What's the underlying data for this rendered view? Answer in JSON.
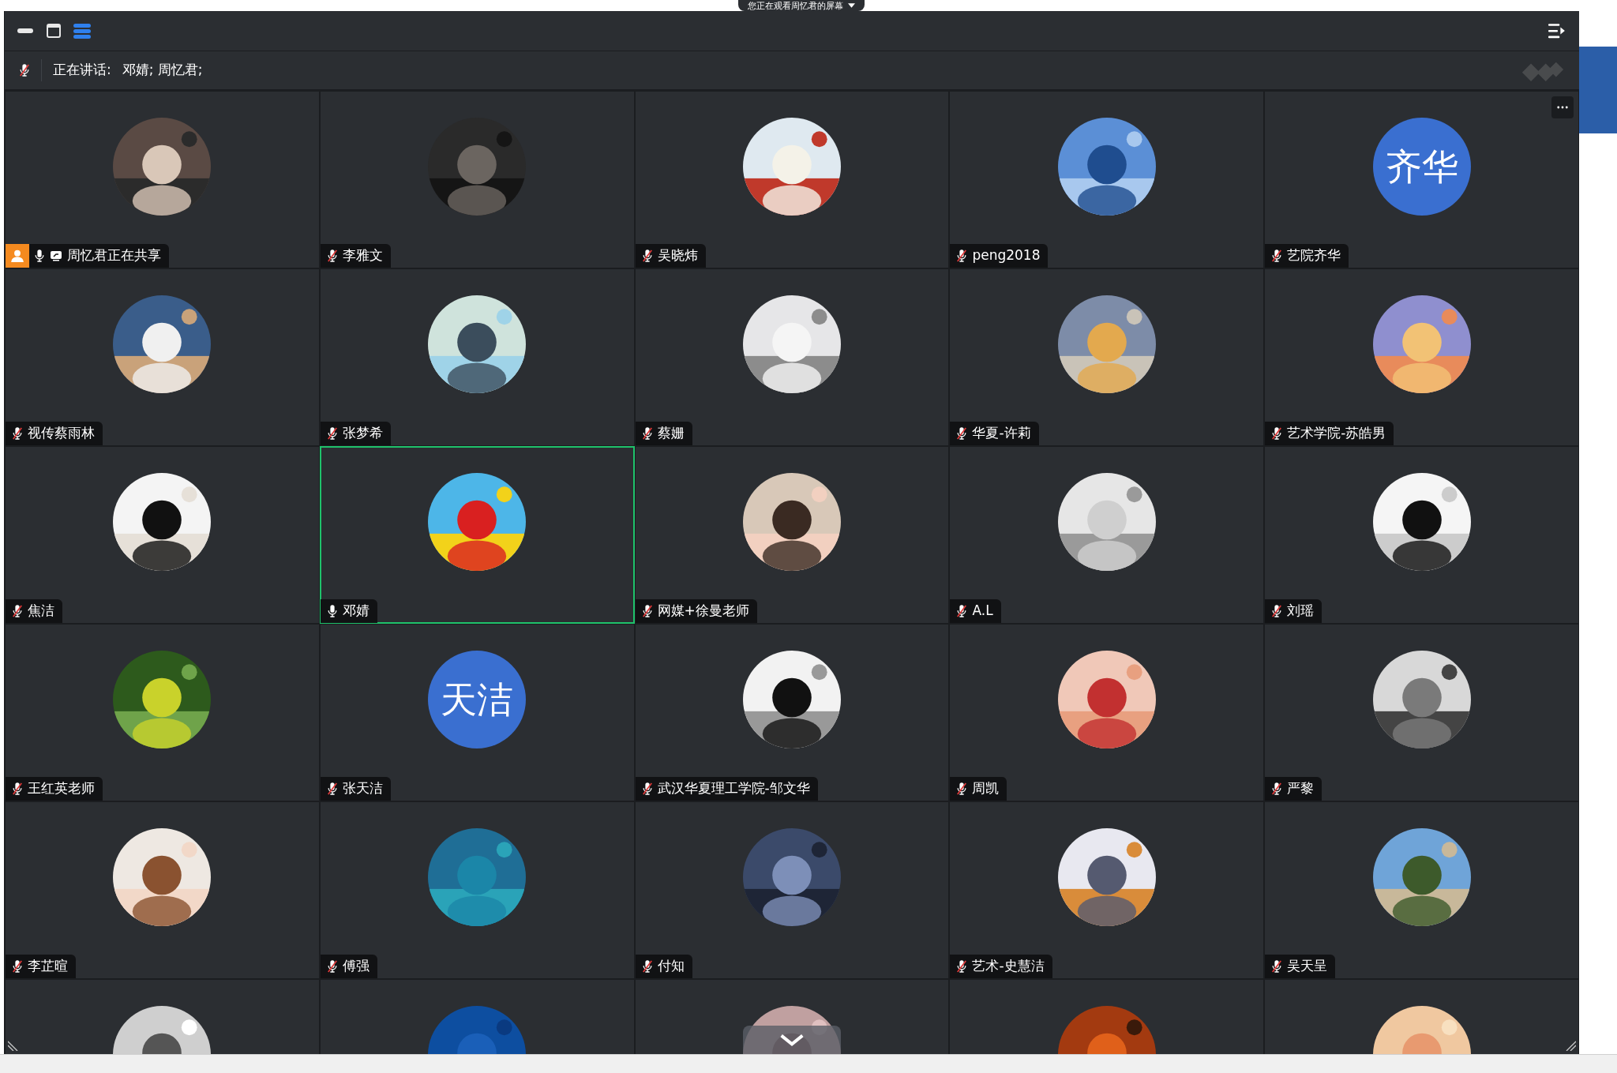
{
  "banner": {
    "text": "您正在观看周忆君的屏幕"
  },
  "speaking_bar": {
    "label": "正在讲话:",
    "names": "邓婧; 周忆君;"
  },
  "participants": [
    {
      "name": "周忆君正在共享",
      "muted": false,
      "sharing": true,
      "selected": false
    },
    {
      "name": "李雅文",
      "muted": true,
      "sharing": false,
      "selected": false
    },
    {
      "name": "吴晓炜",
      "muted": true,
      "sharing": false,
      "selected": false
    },
    {
      "name": "peng2018",
      "muted": true,
      "sharing": false,
      "selected": false
    },
    {
      "name": "艺院齐华",
      "muted": true,
      "sharing": false,
      "selected": false,
      "avatar": {
        "kind": "text",
        "text": "齐华"
      }
    },
    {
      "name": "视传蔡雨林",
      "muted": true,
      "sharing": false,
      "selected": false
    },
    {
      "name": "张梦希",
      "muted": true,
      "sharing": false,
      "selected": false
    },
    {
      "name": "蔡姗",
      "muted": true,
      "sharing": false,
      "selected": false
    },
    {
      "name": "华夏-许莉",
      "muted": true,
      "sharing": false,
      "selected": false
    },
    {
      "name": "艺术学院-苏皓男",
      "muted": true,
      "sharing": false,
      "selected": false
    },
    {
      "name": "焦洁",
      "muted": true,
      "sharing": false,
      "selected": false
    },
    {
      "name": "邓婧",
      "muted": false,
      "sharing": false,
      "selected": true
    },
    {
      "name": "网媒+徐曼老师",
      "muted": true,
      "sharing": false,
      "selected": false
    },
    {
      "name": "A.L",
      "muted": true,
      "sharing": false,
      "selected": false
    },
    {
      "name": "刘瑶",
      "muted": true,
      "sharing": false,
      "selected": false
    },
    {
      "name": "王红英老师",
      "muted": true,
      "sharing": false,
      "selected": false
    },
    {
      "name": "张天洁",
      "muted": true,
      "sharing": false,
      "selected": false,
      "avatar": {
        "kind": "text",
        "text": "天洁"
      }
    },
    {
      "name": "武汉华夏理工学院-邹文华",
      "muted": true,
      "sharing": false,
      "selected": false
    },
    {
      "name": "周凯",
      "muted": true,
      "sharing": false,
      "selected": false
    },
    {
      "name": "严黎",
      "muted": true,
      "sharing": false,
      "selected": false
    },
    {
      "name": "李芷暄",
      "muted": true,
      "sharing": false,
      "selected": false
    },
    {
      "name": "傅强",
      "muted": true,
      "sharing": false,
      "selected": false
    },
    {
      "name": "付知",
      "muted": true,
      "sharing": false,
      "selected": false
    },
    {
      "name": "艺术-史慧洁",
      "muted": true,
      "sharing": false,
      "selected": false
    },
    {
      "name": "吴天呈",
      "muted": true,
      "sharing": false,
      "selected": false
    },
    {
      "selected": false
    },
    {
      "selected": false
    },
    {
      "selected": false
    },
    {
      "selected": false
    },
    {
      "selected": false
    }
  ]
}
